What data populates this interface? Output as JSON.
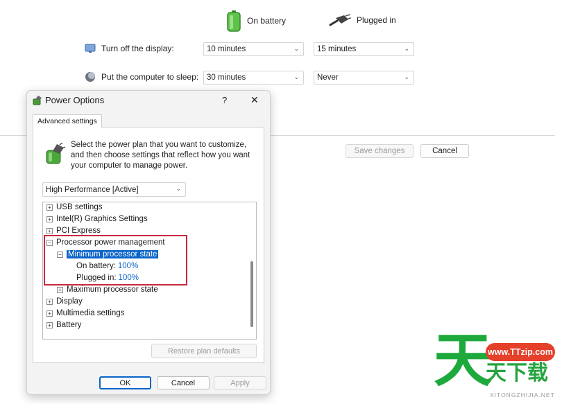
{
  "plan_window": {
    "columns": {
      "battery": "On battery",
      "plugged": "Plugged in"
    },
    "rows": [
      {
        "label": "Turn off the display:",
        "battery": "10 minutes",
        "plugged": "15 minutes"
      },
      {
        "label": "Put the computer to sleep:",
        "battery": "30 minutes",
        "plugged": "Never"
      }
    ],
    "save_label": "Save changes",
    "cancel_label": "Cancel"
  },
  "dialog": {
    "title": "Power Options",
    "help_glyph": "?",
    "close_glyph": "✕",
    "tab_label": "Advanced settings",
    "description": "Select the power plan that you want to customize, and then choose settings that reflect how you want your computer to manage power.",
    "plan_selected": "High Performance [Active]",
    "tree": [
      {
        "label": "USB settings",
        "toggle": "+"
      },
      {
        "label": "Intel(R) Graphics Settings",
        "toggle": "+"
      },
      {
        "label": "PCI Express",
        "toggle": "+"
      },
      {
        "label": "Processor power management",
        "toggle": "−"
      },
      {
        "label": "Minimum processor state",
        "toggle": "−"
      },
      {
        "label": "On battery:",
        "value": "100%"
      },
      {
        "label": "Plugged in:",
        "value": "100%"
      },
      {
        "label": "Maximum processor state",
        "toggle": "+"
      },
      {
        "label": "Display",
        "toggle": "+"
      },
      {
        "label": "Multimedia settings",
        "toggle": "+"
      },
      {
        "label": "Battery",
        "toggle": "+"
      }
    ],
    "restore_label": "Restore plan defaults",
    "ok_label": "OK",
    "cancel_label": "Cancel",
    "apply_label": "Apply"
  },
  "watermark": {
    "big_char": "天",
    "url": "www.TTzip.com",
    "name": "天下载",
    "pinyin": "XITONGZHIJIA.NET"
  },
  "colors": {
    "accent": "#0a64c8",
    "highlight_box": "#c8283c",
    "watermark_green": "#1ea93c",
    "watermark_red": "#e5402a"
  }
}
